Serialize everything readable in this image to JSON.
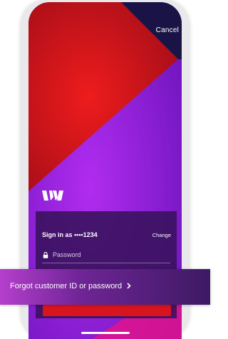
{
  "header": {
    "cancel_label": "Cancel"
  },
  "brand": {
    "logo_icon": "westpac-w-logo-icon",
    "logo_color": "#ffffff"
  },
  "login_card": {
    "signin_label": "Sign in as",
    "masked_customer_id": "••••1234",
    "change_label": "Change",
    "password_placeholder": "Password",
    "lock_icon": "lock-icon"
  },
  "forgot_link": {
    "label": "Forgot customer ID or password",
    "chevron_icon": "chevron-right-icon"
  },
  "colors": {
    "brand_red": "#d8151f",
    "brand_purple": "#8a1fd0",
    "navy": "#1a1446",
    "card_bg": "#361258"
  }
}
